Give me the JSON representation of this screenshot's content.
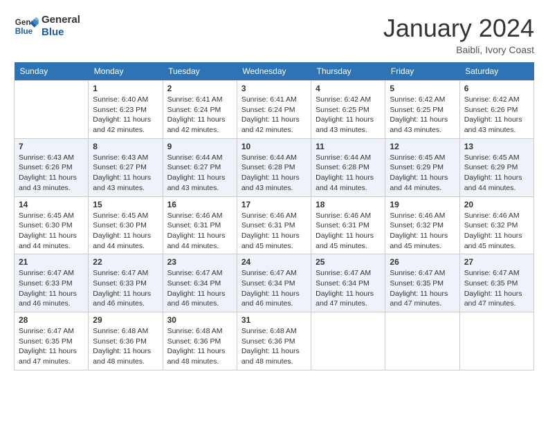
{
  "header": {
    "logo_line1": "General",
    "logo_line2": "Blue",
    "month": "January 2024",
    "location": "Baibli, Ivory Coast"
  },
  "weekdays": [
    "Sunday",
    "Monday",
    "Tuesday",
    "Wednesday",
    "Thursday",
    "Friday",
    "Saturday"
  ],
  "weeks": [
    [
      {
        "day": "",
        "sunrise": "",
        "sunset": "",
        "daylight": ""
      },
      {
        "day": "1",
        "sunrise": "Sunrise: 6:40 AM",
        "sunset": "Sunset: 6:23 PM",
        "daylight": "Daylight: 11 hours and 42 minutes."
      },
      {
        "day": "2",
        "sunrise": "Sunrise: 6:41 AM",
        "sunset": "Sunset: 6:24 PM",
        "daylight": "Daylight: 11 hours and 42 minutes."
      },
      {
        "day": "3",
        "sunrise": "Sunrise: 6:41 AM",
        "sunset": "Sunset: 6:24 PM",
        "daylight": "Daylight: 11 hours and 42 minutes."
      },
      {
        "day": "4",
        "sunrise": "Sunrise: 6:42 AM",
        "sunset": "Sunset: 6:25 PM",
        "daylight": "Daylight: 11 hours and 43 minutes."
      },
      {
        "day": "5",
        "sunrise": "Sunrise: 6:42 AM",
        "sunset": "Sunset: 6:25 PM",
        "daylight": "Daylight: 11 hours and 43 minutes."
      },
      {
        "day": "6",
        "sunrise": "Sunrise: 6:42 AM",
        "sunset": "Sunset: 6:26 PM",
        "daylight": "Daylight: 11 hours and 43 minutes."
      }
    ],
    [
      {
        "day": "7",
        "sunrise": "Sunrise: 6:43 AM",
        "sunset": "Sunset: 6:26 PM",
        "daylight": "Daylight: 11 hours and 43 minutes."
      },
      {
        "day": "8",
        "sunrise": "Sunrise: 6:43 AM",
        "sunset": "Sunset: 6:27 PM",
        "daylight": "Daylight: 11 hours and 43 minutes."
      },
      {
        "day": "9",
        "sunrise": "Sunrise: 6:44 AM",
        "sunset": "Sunset: 6:27 PM",
        "daylight": "Daylight: 11 hours and 43 minutes."
      },
      {
        "day": "10",
        "sunrise": "Sunrise: 6:44 AM",
        "sunset": "Sunset: 6:28 PM",
        "daylight": "Daylight: 11 hours and 43 minutes."
      },
      {
        "day": "11",
        "sunrise": "Sunrise: 6:44 AM",
        "sunset": "Sunset: 6:28 PM",
        "daylight": "Daylight: 11 hours and 44 minutes."
      },
      {
        "day": "12",
        "sunrise": "Sunrise: 6:45 AM",
        "sunset": "Sunset: 6:29 PM",
        "daylight": "Daylight: 11 hours and 44 minutes."
      },
      {
        "day": "13",
        "sunrise": "Sunrise: 6:45 AM",
        "sunset": "Sunset: 6:29 PM",
        "daylight": "Daylight: 11 hours and 44 minutes."
      }
    ],
    [
      {
        "day": "14",
        "sunrise": "Sunrise: 6:45 AM",
        "sunset": "Sunset: 6:30 PM",
        "daylight": "Daylight: 11 hours and 44 minutes."
      },
      {
        "day": "15",
        "sunrise": "Sunrise: 6:45 AM",
        "sunset": "Sunset: 6:30 PM",
        "daylight": "Daylight: 11 hours and 44 minutes."
      },
      {
        "day": "16",
        "sunrise": "Sunrise: 6:46 AM",
        "sunset": "Sunset: 6:31 PM",
        "daylight": "Daylight: 11 hours and 44 minutes."
      },
      {
        "day": "17",
        "sunrise": "Sunrise: 6:46 AM",
        "sunset": "Sunset: 6:31 PM",
        "daylight": "Daylight: 11 hours and 45 minutes."
      },
      {
        "day": "18",
        "sunrise": "Sunrise: 6:46 AM",
        "sunset": "Sunset: 6:31 PM",
        "daylight": "Daylight: 11 hours and 45 minutes."
      },
      {
        "day": "19",
        "sunrise": "Sunrise: 6:46 AM",
        "sunset": "Sunset: 6:32 PM",
        "daylight": "Daylight: 11 hours and 45 minutes."
      },
      {
        "day": "20",
        "sunrise": "Sunrise: 6:46 AM",
        "sunset": "Sunset: 6:32 PM",
        "daylight": "Daylight: 11 hours and 45 minutes."
      }
    ],
    [
      {
        "day": "21",
        "sunrise": "Sunrise: 6:47 AM",
        "sunset": "Sunset: 6:33 PM",
        "daylight": "Daylight: 11 hours and 46 minutes."
      },
      {
        "day": "22",
        "sunrise": "Sunrise: 6:47 AM",
        "sunset": "Sunset: 6:33 PM",
        "daylight": "Daylight: 11 hours and 46 minutes."
      },
      {
        "day": "23",
        "sunrise": "Sunrise: 6:47 AM",
        "sunset": "Sunset: 6:34 PM",
        "daylight": "Daylight: 11 hours and 46 minutes."
      },
      {
        "day": "24",
        "sunrise": "Sunrise: 6:47 AM",
        "sunset": "Sunset: 6:34 PM",
        "daylight": "Daylight: 11 hours and 46 minutes."
      },
      {
        "day": "25",
        "sunrise": "Sunrise: 6:47 AM",
        "sunset": "Sunset: 6:34 PM",
        "daylight": "Daylight: 11 hours and 47 minutes."
      },
      {
        "day": "26",
        "sunrise": "Sunrise: 6:47 AM",
        "sunset": "Sunset: 6:35 PM",
        "daylight": "Daylight: 11 hours and 47 minutes."
      },
      {
        "day": "27",
        "sunrise": "Sunrise: 6:47 AM",
        "sunset": "Sunset: 6:35 PM",
        "daylight": "Daylight: 11 hours and 47 minutes."
      }
    ],
    [
      {
        "day": "28",
        "sunrise": "Sunrise: 6:47 AM",
        "sunset": "Sunset: 6:35 PM",
        "daylight": "Daylight: 11 hours and 47 minutes."
      },
      {
        "day": "29",
        "sunrise": "Sunrise: 6:48 AM",
        "sunset": "Sunset: 6:36 PM",
        "daylight": "Daylight: 11 hours and 48 minutes."
      },
      {
        "day": "30",
        "sunrise": "Sunrise: 6:48 AM",
        "sunset": "Sunset: 6:36 PM",
        "daylight": "Daylight: 11 hours and 48 minutes."
      },
      {
        "day": "31",
        "sunrise": "Sunrise: 6:48 AM",
        "sunset": "Sunset: 6:36 PM",
        "daylight": "Daylight: 11 hours and 48 minutes."
      },
      {
        "day": "",
        "sunrise": "",
        "sunset": "",
        "daylight": ""
      },
      {
        "day": "",
        "sunrise": "",
        "sunset": "",
        "daylight": ""
      },
      {
        "day": "",
        "sunrise": "",
        "sunset": "",
        "daylight": ""
      }
    ]
  ]
}
